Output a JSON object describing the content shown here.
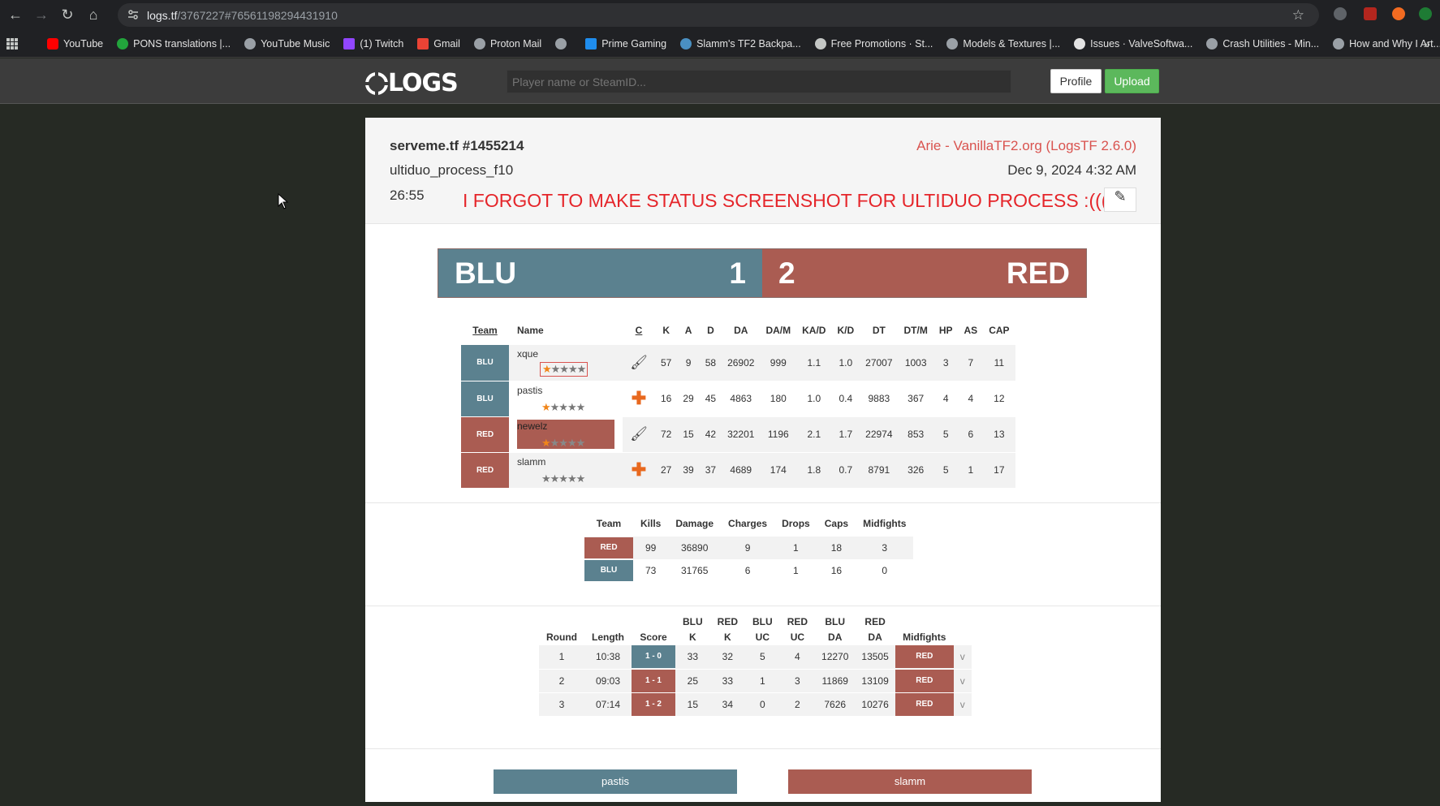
{
  "browser": {
    "url_host": "logs.tf",
    "url_path": "/3767227#76561198294431910",
    "bookmarks": [
      "YouTube",
      "PONS translations |...",
      "YouTube Music",
      "(1) Twitch",
      "Gmail",
      "Proton Mail",
      "",
      "Prime Gaming",
      "Slamm's TF2 Backpa...",
      "Free Promotions · St...",
      "Models & Textures |...",
      "Issues · ValveSoftwa...",
      "Crash Utilities - Min...",
      "How and Why I Art..."
    ]
  },
  "site": {
    "logo": "LOGS",
    "search_placeholder": "Player name or SteamID...",
    "profile_label": "Profile",
    "upload_label": "Upload"
  },
  "log": {
    "title": "serveme.tf #1455214",
    "map": "ultiduo_process_f10",
    "length": "26:55",
    "uploader": "Arie - VanillaTF2.org (LogsTF 2.6.0)",
    "date": "Dec 9, 2024 4:32 AM",
    "note": "I FORGOT TO MAKE STATUS SCREENSHOT FOR ULTIDUO PROCESS :((("
  },
  "score": {
    "blu_name": "BLU",
    "blu_score": "1",
    "red_name": "RED",
    "red_score": "2",
    "colors": {
      "blu": "#5b818f",
      "red": "#aa5c52"
    }
  },
  "players": {
    "headers": [
      "Team",
      "Name",
      "C",
      "K",
      "A",
      "D",
      "DA",
      "DA/M",
      "KA/D",
      "K/D",
      "DT",
      "DT/M",
      "HP",
      "AS",
      "CAP"
    ],
    "rows": [
      {
        "team": "BLU",
        "name": "xque",
        "class": "demoman-icon",
        "stars": 1,
        "k": "57",
        "a": "9",
        "d": "58",
        "da": "26902",
        "dam": "999",
        "kad": "1.1",
        "kd": "1.0",
        "dt": "27007",
        "dtm": "1003",
        "hp": "3",
        "as": "7",
        "cap": "11"
      },
      {
        "team": "BLU",
        "name": "pastis",
        "class": "medic-icon",
        "stars": 1,
        "k": "16",
        "a": "29",
        "d": "45",
        "da": "4863",
        "dam": "180",
        "kad": "1.0",
        "kd": "0.4",
        "dt": "9883",
        "dtm": "367",
        "hp": "4",
        "as": "4",
        "cap": "12"
      },
      {
        "team": "RED",
        "name": "newelz",
        "class": "demoman-icon",
        "stars": 1,
        "k": "72",
        "a": "15",
        "d": "42",
        "da": "32201",
        "dam": "1196",
        "kad": "2.1",
        "kd": "1.7",
        "dt": "22974",
        "dtm": "853",
        "hp": "5",
        "as": "6",
        "cap": "13"
      },
      {
        "team": "RED",
        "name": "slamm",
        "class": "medic-icon",
        "stars": 0,
        "k": "27",
        "a": "39",
        "d": "37",
        "da": "4689",
        "dam": "174",
        "kad": "1.8",
        "kd": "0.7",
        "dt": "8791",
        "dtm": "326",
        "hp": "5",
        "as": "1",
        "cap": "17"
      }
    ]
  },
  "team_stats": {
    "headers": [
      "Team",
      "Kills",
      "Damage",
      "Charges",
      "Drops",
      "Caps",
      "Midfights"
    ],
    "rows": [
      {
        "team": "RED",
        "kills": "99",
        "damage": "36890",
        "charges": "9",
        "drops": "1",
        "caps": "18",
        "midfights": "3"
      },
      {
        "team": "BLU",
        "kills": "73",
        "damage": "31765",
        "charges": "6",
        "drops": "1",
        "caps": "16",
        "midfights": "0"
      }
    ]
  },
  "rounds": {
    "headers": [
      "Round",
      "Length",
      "Score",
      "BLU K",
      "RED K",
      "BLU UC",
      "RED UC",
      "BLU DA",
      "RED DA",
      "Midfights"
    ],
    "h2": {
      "bluk1": "BLU",
      "bluk2": "K",
      "redk1": "RED",
      "redk2": "K",
      "bluuc1": "BLU",
      "bluuc2": "UC",
      "reduc1": "RED",
      "reduc2": "UC",
      "bluda1": "BLU",
      "bluda2": "DA",
      "redda1": "RED",
      "redda2": "DA"
    },
    "rows": [
      {
        "round": "1",
        "length": "10:38",
        "score": "1 - 0",
        "score_team": "BLU",
        "bluk": "33",
        "redk": "32",
        "bluuc": "5",
        "reduc": "4",
        "bluda": "12270",
        "redda": "13505",
        "mid": "RED",
        "expand": "v"
      },
      {
        "round": "2",
        "length": "09:03",
        "score": "1 - 1",
        "score_team": "RED",
        "bluk": "25",
        "redk": "33",
        "bluuc": "1",
        "reduc": "3",
        "bluda": "11869",
        "redda": "13109",
        "mid": "RED",
        "expand": "v"
      },
      {
        "round": "3",
        "length": "07:14",
        "score": "1 - 2",
        "score_team": "RED",
        "bluk": "15",
        "redk": "34",
        "bluuc": "0",
        "reduc": "2",
        "bluda": "7626",
        "redda": "10276",
        "mid": "RED",
        "expand": "v"
      }
    ]
  },
  "healers": {
    "blu": "pastis",
    "red": "slamm"
  }
}
